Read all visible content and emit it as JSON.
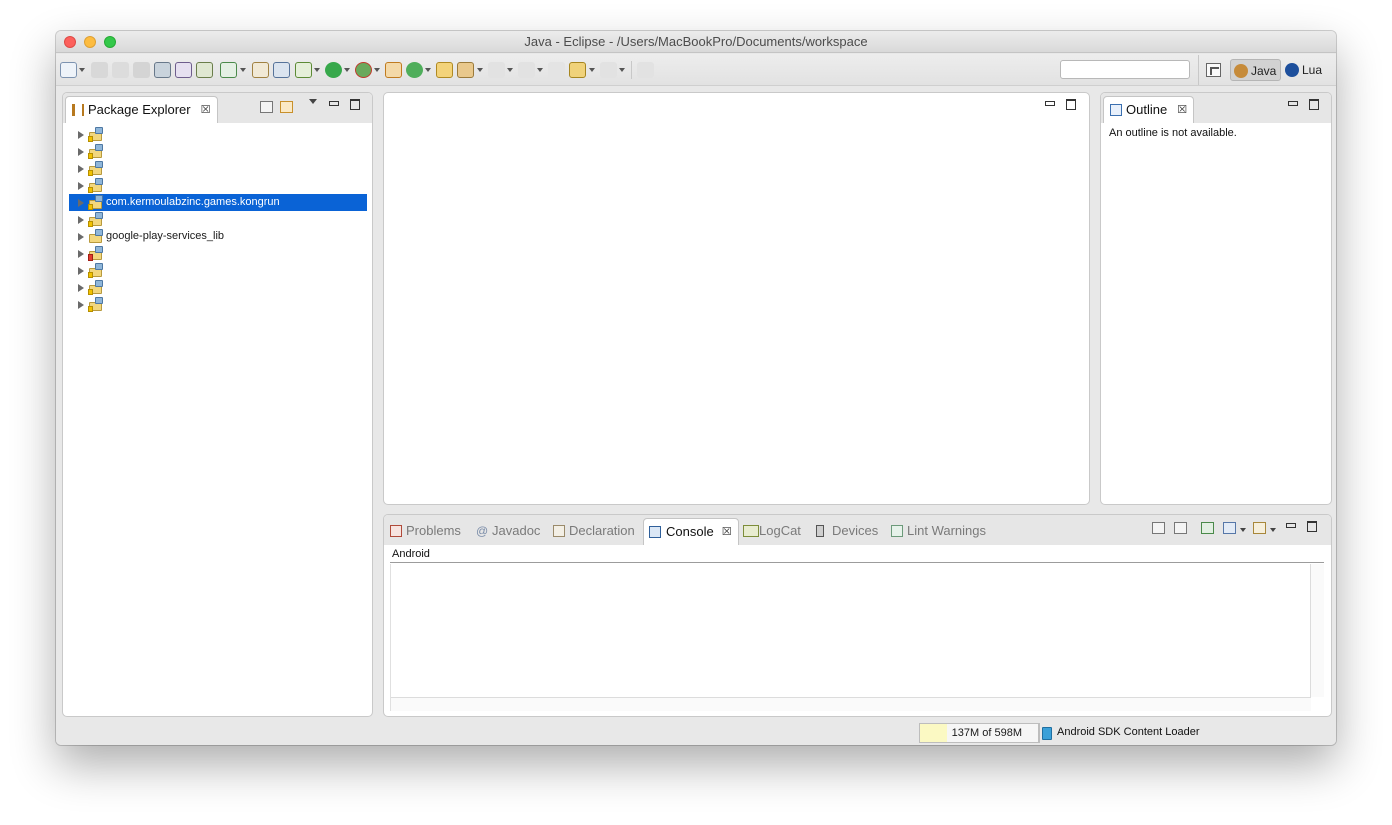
{
  "window": {
    "title": "Java - Eclipse - /Users/MacBookPro/Documents/workspace"
  },
  "search": {
    "placeholder": ""
  },
  "perspectives": {
    "java_label": "Java",
    "lua_label": "Lua"
  },
  "package_explorer": {
    "tab_label": "Package Explorer",
    "close_glyph": "☒",
    "projects": [
      {
        "label": "",
        "marker": "warn",
        "selected": false
      },
      {
        "label": "",
        "marker": "warn",
        "selected": false
      },
      {
        "label": "",
        "marker": "warn",
        "selected": false
      },
      {
        "label": "",
        "marker": "warn",
        "selected": false
      },
      {
        "label": "com.kermoulabzinc.games.kongrun",
        "marker": "warn",
        "selected": true
      },
      {
        "label": "",
        "marker": "warn",
        "selected": false
      },
      {
        "label": "google-play-services_lib",
        "marker": "none",
        "selected": false
      },
      {
        "label": "",
        "marker": "error",
        "selected": false
      },
      {
        "label": "",
        "marker": "warn",
        "selected": false
      },
      {
        "label": "",
        "marker": "warn",
        "selected": false
      },
      {
        "label": "",
        "marker": "warn",
        "selected": false
      }
    ]
  },
  "outline": {
    "tab_label": "Outline",
    "close_glyph": "☒",
    "message": "An outline is not available."
  },
  "console": {
    "tabs": {
      "problems": "Problems",
      "javadoc": "Javadoc",
      "declaration": "Declaration",
      "console": "Console",
      "logcat": "LogCat",
      "devices": "Devices",
      "lint": "Lint Warnings"
    },
    "close_glyph": "☒",
    "header": "Android"
  },
  "status": {
    "heap_text": "137M of 598M",
    "heap_fraction": 0.23,
    "loader_text": "Android SDK Content Loader"
  },
  "colors": {
    "selection": "#0a63d6",
    "heap_fill": "#fbf9c3"
  }
}
